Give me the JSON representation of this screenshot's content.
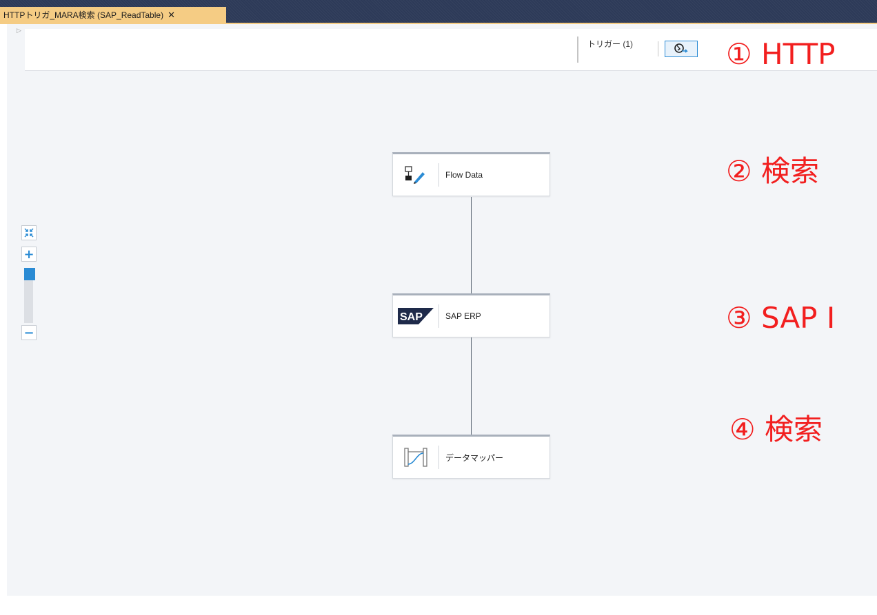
{
  "tab": {
    "title": "HTTPトリガ_MARA検索 (SAP_ReadTable)",
    "close": "✕"
  },
  "toolbar": {
    "trigger_label": "トリガー (1)",
    "trigger_icon": "trigger-settings-icon"
  },
  "zoom": {
    "fit_icon": "fit-to-screen-icon",
    "zoom_in": "+",
    "zoom_out": "−",
    "level": 0.1
  },
  "flow": {
    "nodes": [
      {
        "label": "Flow Data",
        "icon": "flow-data-edit-icon"
      },
      {
        "label": "SAP ERP",
        "icon": "sap-logo-icon"
      },
      {
        "label": "データマッパー",
        "icon": "data-mapper-icon"
      }
    ]
  },
  "annotations": [
    "① HTTP",
    "② 検索",
    "③ SAP I",
    "④ 検索"
  ],
  "colors": {
    "tab_bg": "#f5cc84",
    "title_bar": "#2d3a58",
    "accent_blue": "#2a8bd4",
    "annotation_red": "#f21f1f",
    "canvas_bg": "#f3f5f8"
  }
}
